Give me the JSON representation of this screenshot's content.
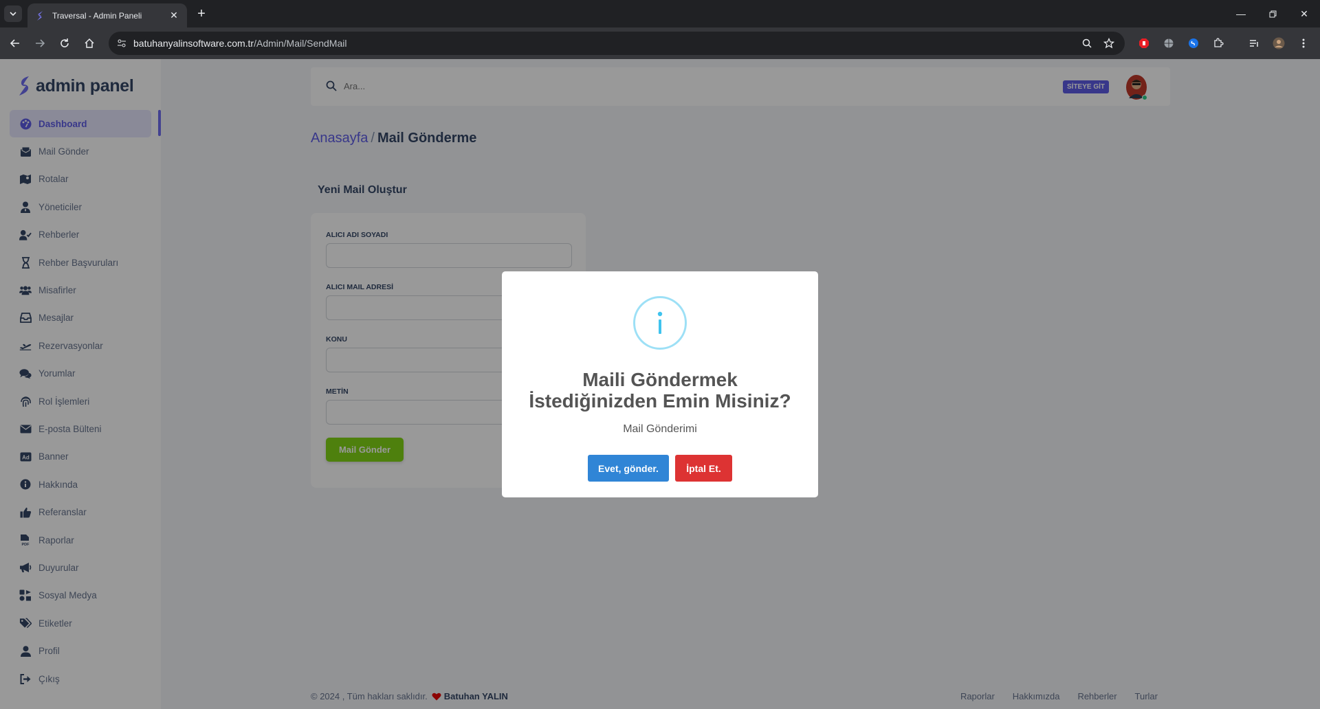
{
  "browser": {
    "tab_title": "Traversal - Admin Paneli",
    "url_host": "batuhanyalinsoftware.com.tr",
    "url_path": "/Admin/Mail/SendMail"
  },
  "brand": {
    "text": "admin panel",
    "accent_color": "#5e5ce6"
  },
  "sidebar": {
    "items": [
      {
        "label": "Dashboard",
        "icon": "palette-icon",
        "active": true
      },
      {
        "label": "Mail Gönder",
        "icon": "mail-box-icon"
      },
      {
        "label": "Rotalar",
        "icon": "map-icon"
      },
      {
        "label": "Yöneticiler",
        "icon": "user-tie-icon"
      },
      {
        "label": "Rehberler",
        "icon": "user-check-icon"
      },
      {
        "label": "Rehber Başvuruları",
        "icon": "hourglass-icon"
      },
      {
        "label": "Misafirler",
        "icon": "users-icon"
      },
      {
        "label": "Mesajlar",
        "icon": "inbox-icon"
      },
      {
        "label": "Rezervasyonlar",
        "icon": "plane-icon"
      },
      {
        "label": "Yorumlar",
        "icon": "comments-icon"
      },
      {
        "label": "Rol İşlemleri",
        "icon": "fingerprint-icon"
      },
      {
        "label": "E-posta Bülteni",
        "icon": "envelope-icon"
      },
      {
        "label": "Banner",
        "icon": "ad-icon"
      },
      {
        "label": "Hakkında",
        "icon": "info-icon"
      },
      {
        "label": "Referanslar",
        "icon": "thumbs-up-icon"
      },
      {
        "label": "Raporlar",
        "icon": "pdf-icon"
      },
      {
        "label": "Duyurular",
        "icon": "megaphone-icon"
      },
      {
        "label": "Sosyal Medya",
        "icon": "share-icon"
      },
      {
        "label": "Etiketler",
        "icon": "tags-icon"
      },
      {
        "label": "Profil",
        "icon": "user-icon"
      },
      {
        "label": "Çıkış",
        "icon": "logout-icon"
      }
    ]
  },
  "topbar": {
    "search_placeholder": "Ara...",
    "site_button": "SİTEYE GİT"
  },
  "breadcrumb": {
    "home": "Anasayfa",
    "separator": "/",
    "current": "Mail Gönderme"
  },
  "form": {
    "title": "Yeni Mail Oluştur",
    "fields": [
      {
        "label": "ALICI ADI SOYADI",
        "value": ""
      },
      {
        "label": "ALICI MAIL ADRESİ",
        "value": ""
      },
      {
        "label": "KONU",
        "value": ""
      },
      {
        "label": "METİN",
        "value": ""
      }
    ],
    "submit": "Mail Gönder"
  },
  "footer": {
    "copyright": "© 2024 , Tüm hakları saklıdır.",
    "author": "Batuhan YALIN",
    "links": [
      "Raporlar",
      "Hakkımızda",
      "Rehberler",
      "Turlar"
    ]
  },
  "modal": {
    "icon": "info-icon",
    "title": "Maili Göndermek İstediğinizden Emin Misiniz?",
    "text": "Mail Gönderimi",
    "confirm": "Evet, gönder.",
    "cancel": "İptal Et.",
    "confirm_color": "#3085d6",
    "cancel_color": "#dd3333"
  }
}
